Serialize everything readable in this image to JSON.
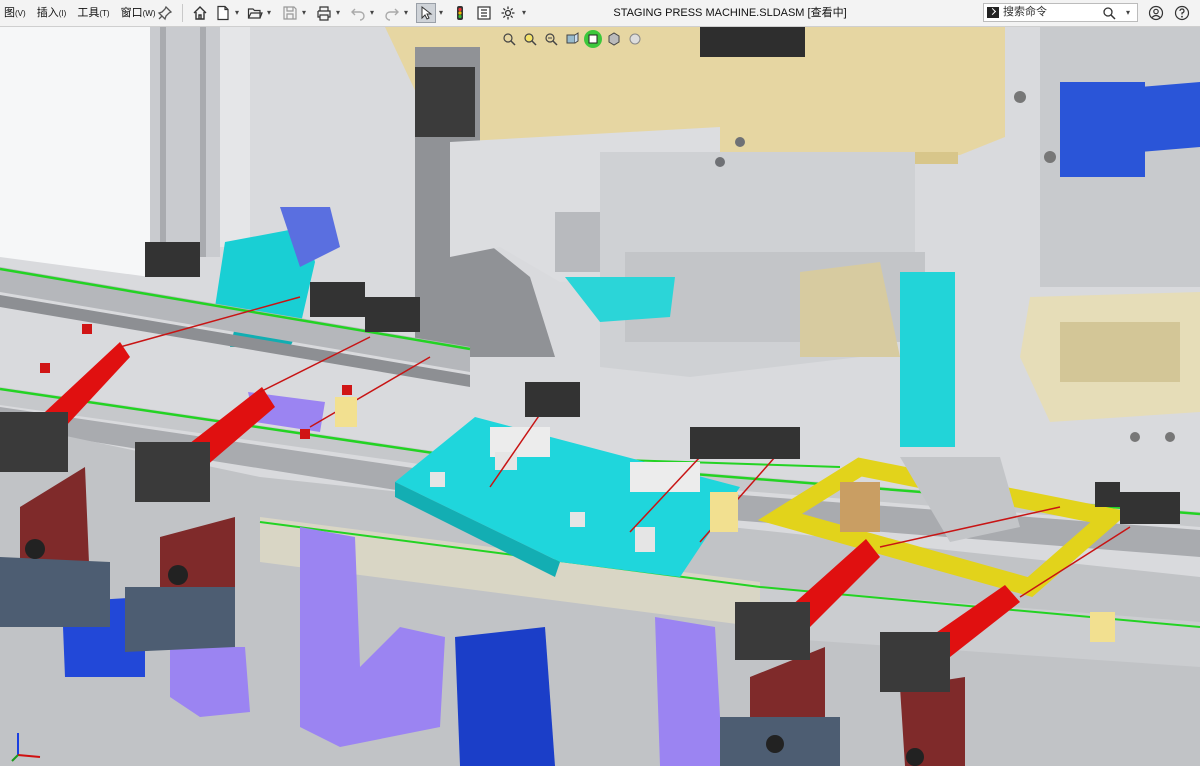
{
  "menu": {
    "items": [
      {
        "label": "图",
        "key": "(V)"
      },
      {
        "label": "插入",
        "key": "(I)"
      },
      {
        "label": "工具",
        "key": "(T)"
      },
      {
        "label": "窗口",
        "key": "(W)"
      }
    ]
  },
  "toolbar": {
    "icons": [
      "pin-icon",
      "home-icon",
      "new-document-icon",
      "open-folder-icon",
      "save-icon",
      "print-icon",
      "undo-icon",
      "redo-icon",
      "select-arrow-icon",
      "traffic-light-icon",
      "file-properties-icon",
      "options-gear-icon"
    ]
  },
  "window": {
    "title": "STAGING PRESS MACHINE.SLDASM [查看中]"
  },
  "search": {
    "placeholder": "搜索命令"
  },
  "colors": {
    "toolbar_bg": "#f3f3f3",
    "cyan_part": "#1fd6dc",
    "yellow_frame": "#e2d31b",
    "purple_part": "#9b84f2",
    "blue_part": "#1b3ec8",
    "red_sensor": "#e01010",
    "green_belt": "#2bd62b",
    "tan_housing": "#e6d6a2",
    "frame_gray": "#c4c6ca"
  }
}
